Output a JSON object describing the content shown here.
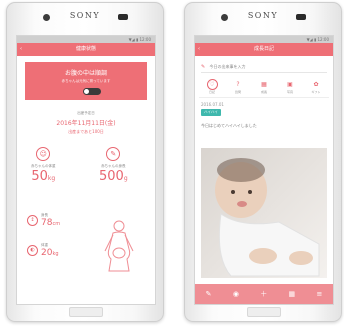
{
  "brand": "SONY",
  "colors": {
    "accent": "#ee6f76",
    "tag": "#3fb8ad",
    "bottom_bar": "#ef8e94"
  },
  "left_phone": {
    "status_text": "▼◢ ▮ 12:00",
    "nav_icon": "back-arrow-icon",
    "title": "健康状態",
    "banner": {
      "line1": "お腹の中は順調",
      "line2": "赤ちゃんは元気に育っています",
      "toggle_on": true
    },
    "due_date": {
      "label": "出産予定日",
      "value": "2016年11月11日(金)",
      "sub": "出産まであと100日"
    },
    "stats": {
      "baby_weight": {
        "icon": "baby-icon",
        "label": "赤ちゃんの体重",
        "value": "50",
        "unit": "kg"
      },
      "fetal_length": {
        "icon": "ruler-icon",
        "label": "赤ちゃんの身長",
        "value": "500",
        "unit": "g"
      },
      "height": {
        "icon": "height-icon",
        "label": "身長",
        "value": "78",
        "unit": "cm"
      },
      "weight": {
        "icon": "scale-icon",
        "label": "体重",
        "value": "20",
        "unit": "kg"
      }
    },
    "figure_icon": "mother-figure-icon"
  },
  "right_phone": {
    "status_text": "▼◢ ▮ 12:00",
    "nav_icon": "back-arrow-icon",
    "title": "成長日記",
    "search_placeholder": "今日の出来事を入力",
    "tabs": [
      {
        "icon": "heart-icon",
        "label": "日記",
        "active": true
      },
      {
        "icon": "question-icon",
        "label": "質問",
        "active": false
      },
      {
        "icon": "chart-icon",
        "label": "成長",
        "active": false
      },
      {
        "icon": "photo-icon",
        "label": "写真",
        "active": false
      },
      {
        "icon": "gift-icon",
        "label": "ギフト",
        "active": false
      }
    ],
    "post_meta": "2016.07.01",
    "post_tag": "ハイハイ",
    "caption": "今日はじめてハイハイしました",
    "photo_alt": "baby-photo",
    "bottom_icons": [
      "diary-icon",
      "camera-icon",
      "plus-icon",
      "chart-icon",
      "menu-icon"
    ]
  }
}
